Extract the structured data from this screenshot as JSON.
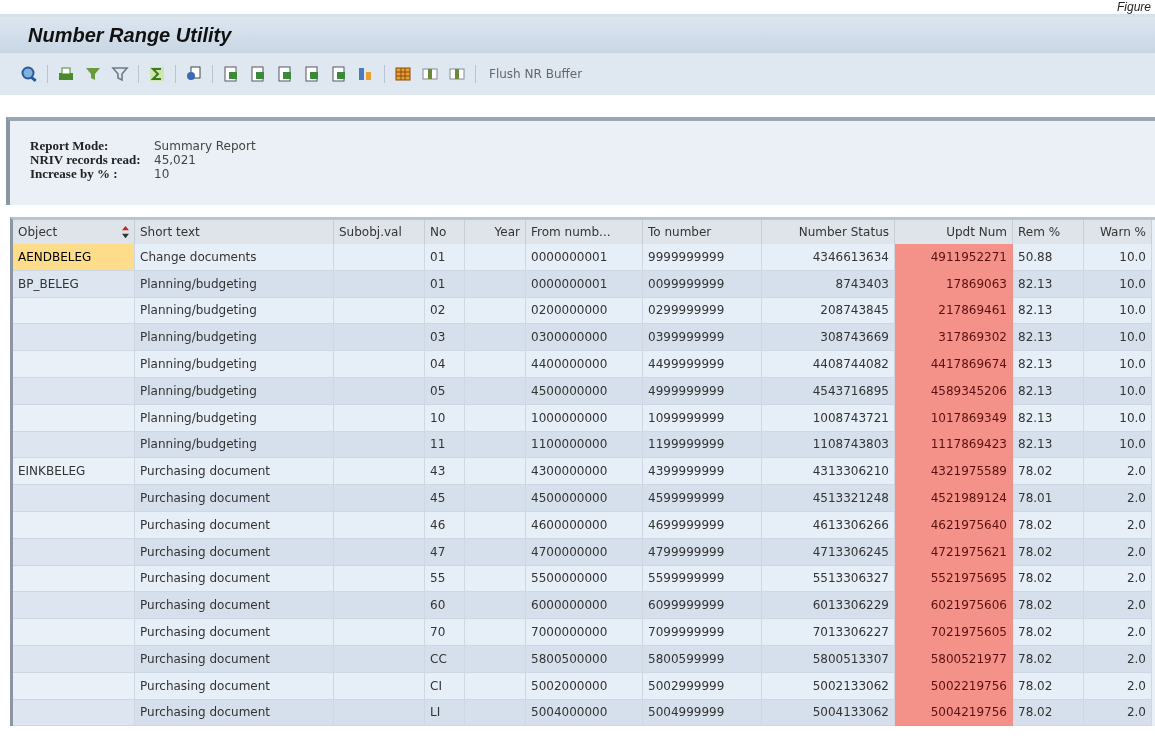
{
  "corner_caption": "Figure",
  "window": {
    "title": "Number Range Utility"
  },
  "toolbar": {
    "button": "Flush NR Buffer"
  },
  "info": [
    {
      "label": "Report Mode:",
      "value": "Summary Report"
    },
    {
      "label": "NRIV records read:",
      "value": "45,021"
    },
    {
      "label": "Increase by % :",
      "value": "10"
    }
  ],
  "table": {
    "columns": [
      {
        "label": "Object",
        "sorted": true,
        "highlight": false
      },
      {
        "label": "Short text",
        "sorted": false,
        "highlight": false
      },
      {
        "label": "Subobj.val",
        "sorted": false,
        "highlight": false
      },
      {
        "label": "No",
        "sorted": false,
        "highlight": false
      },
      {
        "label": "Year",
        "sorted": false,
        "highlight": false
      },
      {
        "label": "From numb...",
        "sorted": false,
        "highlight": false
      },
      {
        "label": "To number",
        "sorted": false,
        "highlight": false
      },
      {
        "label": "Number Status",
        "sorted": false,
        "highlight": false
      },
      {
        "label": "Updt Num",
        "sorted": false,
        "highlight": true
      },
      {
        "label": "Rem %",
        "sorted": false,
        "highlight": false
      },
      {
        "label": "Warn %",
        "sorted": false,
        "highlight": false
      }
    ],
    "rows": [
      {
        "selected": true,
        "cells": [
          "AENDBELEG",
          "Change documents",
          "",
          "01",
          "",
          "0000000001",
          "9999999999",
          "4346613634",
          "4911952271",
          "50.88",
          "10.0"
        ]
      },
      {
        "selected": false,
        "cells": [
          "BP_BELEG",
          "Planning/budgeting",
          "",
          "01",
          "",
          "0000000001",
          "0099999999",
          "8743403",
          "17869063",
          "82.13",
          "10.0"
        ]
      },
      {
        "selected": false,
        "cells": [
          "",
          "Planning/budgeting",
          "",
          "02",
          "",
          "0200000000",
          "0299999999",
          "208743845",
          "217869461",
          "82.13",
          "10.0"
        ]
      },
      {
        "selected": false,
        "cells": [
          "",
          "Planning/budgeting",
          "",
          "03",
          "",
          "0300000000",
          "0399999999",
          "308743669",
          "317869302",
          "82.13",
          "10.0"
        ]
      },
      {
        "selected": false,
        "cells": [
          "",
          "Planning/budgeting",
          "",
          "04",
          "",
          "4400000000",
          "4499999999",
          "4408744082",
          "4417869674",
          "82.13",
          "10.0"
        ]
      },
      {
        "selected": false,
        "cells": [
          "",
          "Planning/budgeting",
          "",
          "05",
          "",
          "4500000000",
          "4999999999",
          "4543716895",
          "4589345206",
          "82.13",
          "10.0"
        ]
      },
      {
        "selected": false,
        "cells": [
          "",
          "Planning/budgeting",
          "",
          "10",
          "",
          "1000000000",
          "1099999999",
          "1008743721",
          "1017869349",
          "82.13",
          "10.0"
        ]
      },
      {
        "selected": false,
        "cells": [
          "",
          "Planning/budgeting",
          "",
          "11",
          "",
          "1100000000",
          "1199999999",
          "1108743803",
          "1117869423",
          "82.13",
          "10.0"
        ]
      },
      {
        "selected": false,
        "cells": [
          "EINKBELEG",
          "Purchasing document",
          "",
          "43",
          "",
          "4300000000",
          "4399999999",
          "4313306210",
          "4321975589",
          "78.02",
          "2.0"
        ]
      },
      {
        "selected": false,
        "cells": [
          "",
          "Purchasing document",
          "",
          "45",
          "",
          "4500000000",
          "4599999999",
          "4513321248",
          "4521989124",
          "78.01",
          "2.0"
        ]
      },
      {
        "selected": false,
        "cells": [
          "",
          "Purchasing document",
          "",
          "46",
          "",
          "4600000000",
          "4699999999",
          "4613306266",
          "4621975640",
          "78.02",
          "2.0"
        ]
      },
      {
        "selected": false,
        "cells": [
          "",
          "Purchasing document",
          "",
          "47",
          "",
          "4700000000",
          "4799999999",
          "4713306245",
          "4721975621",
          "78.02",
          "2.0"
        ]
      },
      {
        "selected": false,
        "cells": [
          "",
          "Purchasing document",
          "",
          "55",
          "",
          "5500000000",
          "5599999999",
          "5513306327",
          "5521975695",
          "78.02",
          "2.0"
        ]
      },
      {
        "selected": false,
        "cells": [
          "",
          "Purchasing document",
          "",
          "60",
          "",
          "6000000000",
          "6099999999",
          "6013306229",
          "6021975606",
          "78.02",
          "2.0"
        ]
      },
      {
        "selected": false,
        "cells": [
          "",
          "Purchasing document",
          "",
          "70",
          "",
          "7000000000",
          "7099999999",
          "7013306227",
          "7021975605",
          "78.02",
          "2.0"
        ]
      },
      {
        "selected": false,
        "cells": [
          "",
          "Purchasing document",
          "",
          "CC",
          "",
          "5800500000",
          "5800599999",
          "5800513307",
          "5800521977",
          "78.02",
          "2.0"
        ]
      },
      {
        "selected": false,
        "cells": [
          "",
          "Purchasing document",
          "",
          "CI",
          "",
          "5002000000",
          "5002999999",
          "5002133062",
          "5002219756",
          "78.02",
          "2.0"
        ]
      },
      {
        "selected": false,
        "cells": [
          "",
          "Purchasing document",
          "",
          "LI",
          "",
          "5004000000",
          "5004999999",
          "5004133062",
          "5004219756",
          "78.02",
          "2.0"
        ]
      }
    ]
  }
}
